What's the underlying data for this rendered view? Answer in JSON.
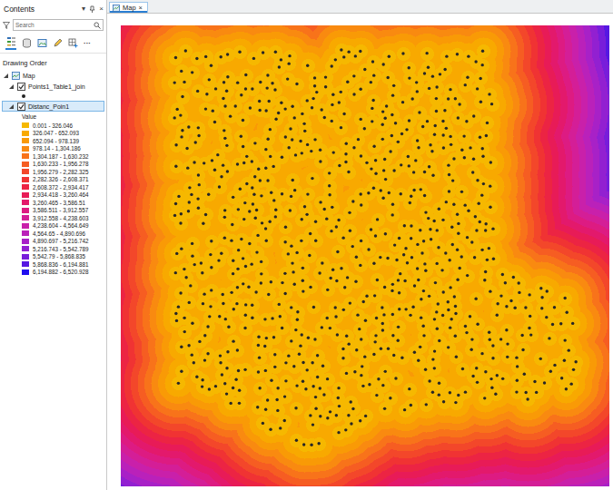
{
  "contents": {
    "title": "Contents",
    "collapse": "▾",
    "close": "×"
  },
  "search": {
    "placeholder": "Search"
  },
  "toolbar": {
    "more": "···"
  },
  "drawing_order": "Drawing Order",
  "map": {
    "label": "Map",
    "expanded": true
  },
  "layers": [
    {
      "label": "Points1_Table1_join",
      "kind": "points",
      "checked": true,
      "expanded": true,
      "selected": false
    },
    {
      "label": "Distanc_Poin1",
      "kind": "raster",
      "checked": true,
      "expanded": true,
      "selected": true,
      "legend": {
        "title": "Value",
        "classes": [
          {
            "label": "0.001 - 326.046",
            "color": "#f6b800"
          },
          {
            "label": "326.047 - 652.093",
            "color": "#f8a900"
          },
          {
            "label": "652.094 - 978.139",
            "color": "#f99a06"
          },
          {
            "label": "978.14 - 1,304.186",
            "color": "#f98a10"
          },
          {
            "label": "1,304.187 - 1,630.232",
            "color": "#f8731a"
          },
          {
            "label": "1,630.233 - 1,956.278",
            "color": "#f65d22"
          },
          {
            "label": "1,956.279 - 2,282.325",
            "color": "#f3472a"
          },
          {
            "label": "2,282.326 - 2,608.371",
            "color": "#f03333"
          },
          {
            "label": "2,608.372 - 2,934.417",
            "color": "#ec2443"
          },
          {
            "label": "2,934.418 - 3,260.464",
            "color": "#e81b57"
          },
          {
            "label": "3,260.465 - 3,586.51",
            "color": "#e3196c"
          },
          {
            "label": "3,586.511 - 3,912.557",
            "color": "#dd1b82"
          },
          {
            "label": "3,912.558 - 4,238.603",
            "color": "#d41e97"
          },
          {
            "label": "4,238.604 - 4,564.649",
            "color": "#c920aa"
          },
          {
            "label": "4,564.65 - 4,890.696",
            "color": "#ba21ba"
          },
          {
            "label": "4,890.697 - 5,216.742",
            "color": "#a821c7"
          },
          {
            "label": "5,216.743 - 5,542.789",
            "color": "#9220d1"
          },
          {
            "label": "5,542.79 - 5,868.835",
            "color": "#781dda"
          },
          {
            "label": "5,868.836 - 6,194.881",
            "color": "#5617e2"
          },
          {
            "label": "6,194.882 - 6,520.928",
            "color": "#200eef"
          }
        ]
      }
    }
  ],
  "map_tab": {
    "label": "Map",
    "selected": true,
    "close": "×"
  }
}
